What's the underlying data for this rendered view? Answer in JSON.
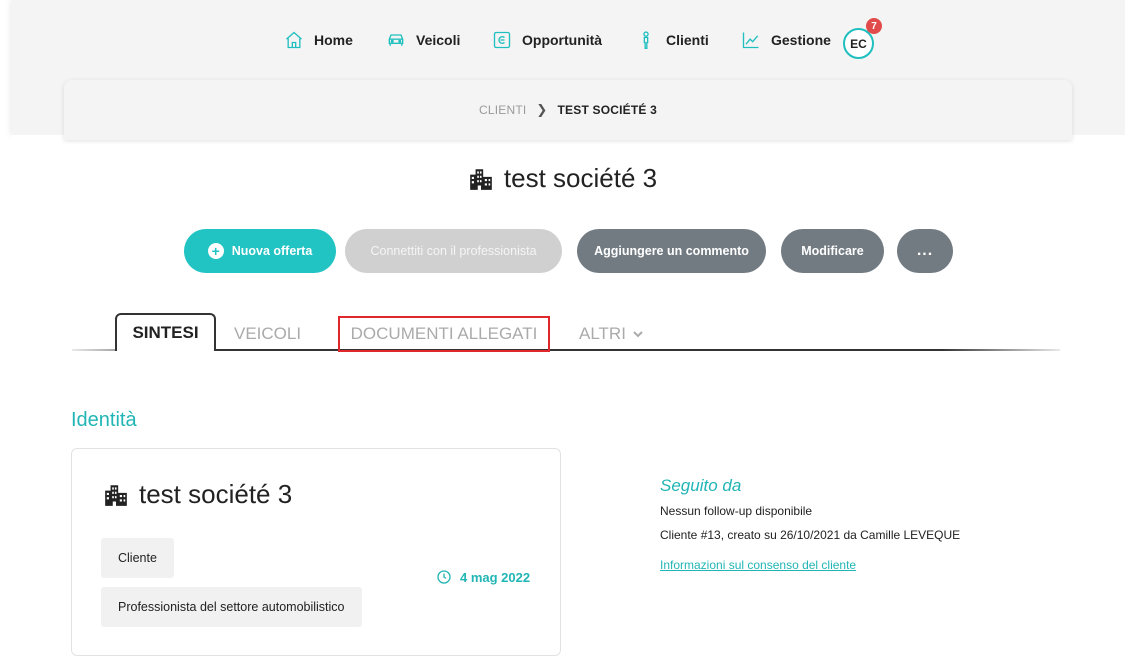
{
  "nav": {
    "items": [
      {
        "label": "Home",
        "icon": "home-icon"
      },
      {
        "label": "Veicoli",
        "icon": "car-icon"
      },
      {
        "label": "Opportunità",
        "icon": "opportunity-icon"
      },
      {
        "label": "Clienti",
        "icon": "client-icon"
      },
      {
        "label": "Gestione",
        "icon": "chart-icon"
      }
    ],
    "avatar_initials": "EC",
    "notification_count": "7"
  },
  "breadcrumb": {
    "parent": "CLIENTI",
    "current": "TEST SOCIÉTÉ 3"
  },
  "page": {
    "title": "test société 3",
    "title_icon": "building-icon"
  },
  "actions": {
    "new_offer": "Nuova offerta",
    "connect": "Connettiti con il professionista",
    "comment": "Aggiungere un commento",
    "edit": "Modificare",
    "more": "..."
  },
  "tabs": {
    "sintesi": "SINTESI",
    "veicoli": "VEICOLI",
    "documenti": "DOCUMENTI ALLEGATI",
    "altri": "ALTRI"
  },
  "identity": {
    "section_title": "Identità",
    "card_title": "test société 3",
    "tag_client": "Cliente",
    "tag_professional": "Professionista del settore automobilistico",
    "date": "4 mag 2022"
  },
  "followed": {
    "title": "Seguito da",
    "no_followup": "Nessun follow-up disponibile",
    "client_info": "Cliente #13, creato su 26/10/2021 da Camille LEVEQUE",
    "consent_link": "Informazioni sul consenso del cliente"
  },
  "colors": {
    "accent": "#22c3c3",
    "grey_button": "#737b82",
    "disabled_button": "#d0d0d0",
    "highlight_border": "#e0272b",
    "badge": "#e24b4b"
  }
}
